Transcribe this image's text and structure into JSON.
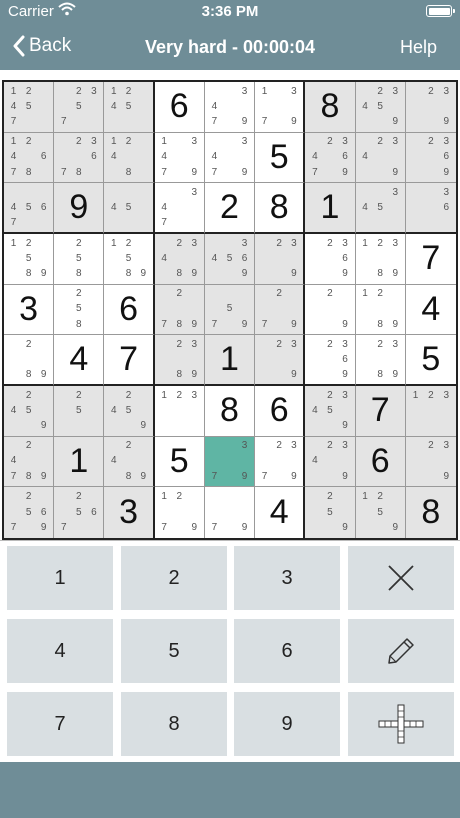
{
  "status_bar": {
    "carrier": "Carrier",
    "time": "3:36 PM"
  },
  "nav": {
    "back_label": "Back",
    "title": "Very hard - 00:00:04",
    "help_label": "Help"
  },
  "colors": {
    "selected_cell": "#5fb5a4",
    "shaded_cell": "#e4e4e4",
    "nav_background": "#6f8d97",
    "key_background": "#d9dfe2"
  },
  "board": {
    "selected": [
      7,
      4
    ],
    "cells": [
      [
        {
          "notes": [
            1,
            2,
            4,
            5,
            7
          ]
        },
        {
          "notes": [
            2,
            3,
            5,
            7
          ]
        },
        {
          "notes": [
            1,
            2,
            4,
            5
          ]
        },
        {
          "value": 6
        },
        {
          "notes": [
            3,
            4,
            7,
            9
          ]
        },
        {
          "notes": [
            1,
            3,
            7,
            9
          ]
        },
        {
          "value": 8
        },
        {
          "notes": [
            2,
            3,
            4,
            5,
            9
          ]
        },
        {
          "notes": [
            2,
            3,
            9
          ]
        }
      ],
      [
        {
          "notes": [
            1,
            2,
            4,
            6,
            7,
            8
          ]
        },
        {
          "notes": [
            2,
            3,
            6,
            7,
            8
          ]
        },
        {
          "notes": [
            1,
            2,
            4,
            8
          ]
        },
        {
          "notes": [
            1,
            3,
            4,
            7,
            9
          ]
        },
        {
          "notes": [
            3,
            4,
            7,
            9
          ]
        },
        {
          "value": 5
        },
        {
          "notes": [
            2,
            3,
            4,
            6,
            7,
            9
          ]
        },
        {
          "notes": [
            2,
            3,
            4,
            9
          ]
        },
        {
          "notes": [
            2,
            3,
            6,
            9
          ]
        }
      ],
      [
        {
          "notes": [
            4,
            5,
            6,
            7
          ]
        },
        {
          "value": 9
        },
        {
          "notes": [
            4,
            5
          ]
        },
        {
          "notes": [
            3,
            4,
            7
          ]
        },
        {
          "value": 2
        },
        {
          "value": 8
        },
        {
          "value": 1
        },
        {
          "notes": [
            3,
            4,
            5
          ]
        },
        {
          "notes": [
            3,
            6
          ]
        }
      ],
      [
        {
          "notes": [
            1,
            2,
            5,
            8,
            9
          ]
        },
        {
          "notes": [
            2,
            5,
            8
          ]
        },
        {
          "notes": [
            1,
            2,
            5,
            8,
            9
          ]
        },
        {
          "notes": [
            2,
            3,
            4,
            8,
            9
          ]
        },
        {
          "notes": [
            3,
            4,
            5,
            6,
            9
          ]
        },
        {
          "notes": [
            2,
            3,
            9
          ]
        },
        {
          "notes": [
            2,
            3,
            6,
            9
          ]
        },
        {
          "notes": [
            1,
            2,
            3,
            8,
            9
          ]
        },
        {
          "value": 7
        }
      ],
      [
        {
          "value": 3
        },
        {
          "notes": [
            2,
            5,
            8
          ]
        },
        {
          "value": 6
        },
        {
          "notes": [
            2,
            7,
            8,
            9
          ]
        },
        {
          "notes": [
            5,
            7,
            9
          ]
        },
        {
          "notes": [
            2,
            7,
            9
          ]
        },
        {
          "notes": [
            2,
            9
          ]
        },
        {
          "notes": [
            1,
            2,
            8,
            9
          ]
        },
        {
          "value": 4
        }
      ],
      [
        {
          "notes": [
            2,
            8,
            9
          ]
        },
        {
          "value": 4
        },
        {
          "value": 7
        },
        {
          "notes": [
            2,
            3,
            8,
            9
          ]
        },
        {
          "value": 1
        },
        {
          "notes": [
            2,
            3,
            9
          ]
        },
        {
          "notes": [
            2,
            3,
            6,
            9
          ]
        },
        {
          "notes": [
            2,
            3,
            8,
            9
          ]
        },
        {
          "value": 5
        }
      ],
      [
        {
          "notes": [
            2,
            4,
            5,
            9
          ]
        },
        {
          "notes": [
            2,
            5
          ]
        },
        {
          "notes": [
            2,
            4,
            5,
            9
          ]
        },
        {
          "notes": [
            1,
            2,
            3
          ]
        },
        {
          "value": 8
        },
        {
          "value": 6
        },
        {
          "notes": [
            2,
            3,
            4,
            5,
            9
          ]
        },
        {
          "value": 7
        },
        {
          "notes": [
            1,
            2,
            3
          ]
        }
      ],
      [
        {
          "notes": [
            2,
            4,
            7,
            8,
            9
          ]
        },
        {
          "value": 1
        },
        {
          "notes": [
            2,
            4,
            8,
            9
          ]
        },
        {
          "value": 5
        },
        {
          "notes": [
            3,
            7,
            9
          ]
        },
        {
          "notes": [
            2,
            3,
            7,
            9
          ]
        },
        {
          "notes": [
            2,
            3,
            4,
            9
          ]
        },
        {
          "value": 6
        },
        {
          "notes": [
            2,
            3,
            9
          ]
        }
      ],
      [
        {
          "notes": [
            2,
            5,
            6,
            7,
            9
          ]
        },
        {
          "notes": [
            2,
            5,
            6,
            7
          ]
        },
        {
          "value": 3
        },
        {
          "notes": [
            1,
            2,
            7,
            9
          ]
        },
        {
          "notes": [
            7,
            9
          ]
        },
        {
          "value": 4
        },
        {
          "notes": [
            2,
            5,
            9
          ]
        },
        {
          "notes": [
            1,
            2,
            5,
            9
          ]
        },
        {
          "value": 8
        }
      ]
    ]
  },
  "keypad": {
    "digits": [
      "1",
      "2",
      "3",
      "4",
      "5",
      "6",
      "7",
      "8",
      "9"
    ],
    "actions": {
      "clear_icon": "x-icon",
      "notes_icon": "pencil-icon",
      "highlight_icon": "crosshair-icon"
    }
  }
}
